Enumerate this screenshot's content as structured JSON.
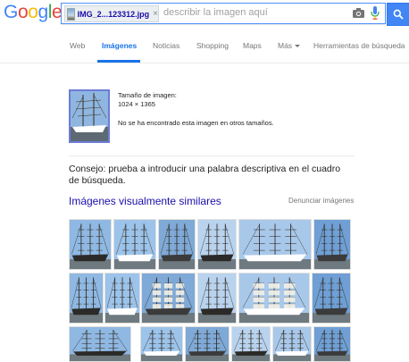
{
  "logo": {
    "letters": [
      "G",
      "o",
      "o",
      "g",
      "l",
      "e"
    ]
  },
  "search": {
    "file_chip": "IMG_2...123312.jpg",
    "chip_close": "×",
    "placeholder": "describir la imagen aquí"
  },
  "tabs": [
    {
      "label": "Web",
      "active": false
    },
    {
      "label": "Imágenes",
      "active": true
    },
    {
      "label": "Noticias",
      "active": false
    },
    {
      "label": "Shopping",
      "active": false
    },
    {
      "label": "Maps",
      "active": false
    },
    {
      "label": "Más",
      "active": false
    },
    {
      "label": "Herramientas de búsqueda",
      "active": false
    }
  ],
  "image_info": {
    "size_label": "Tamaño de imagen:",
    "size_value": "1024 × 1365",
    "not_found": "No se ha encontrado esta imagen en otros tamaños."
  },
  "tip": "Consejo: prueba a introducir una palabra descriptiva en el cuadro de búsqueda.",
  "similar": {
    "title": "Imágenes visualmente similares",
    "report_label": "Denunciar imágenes"
  },
  "colors": {
    "accent": "#1a73e8",
    "link": "#1a0dab",
    "search_button": "#4285f4"
  },
  "icons": [
    "camera-icon",
    "microphone-icon",
    "search-icon",
    "close-icon"
  ]
}
